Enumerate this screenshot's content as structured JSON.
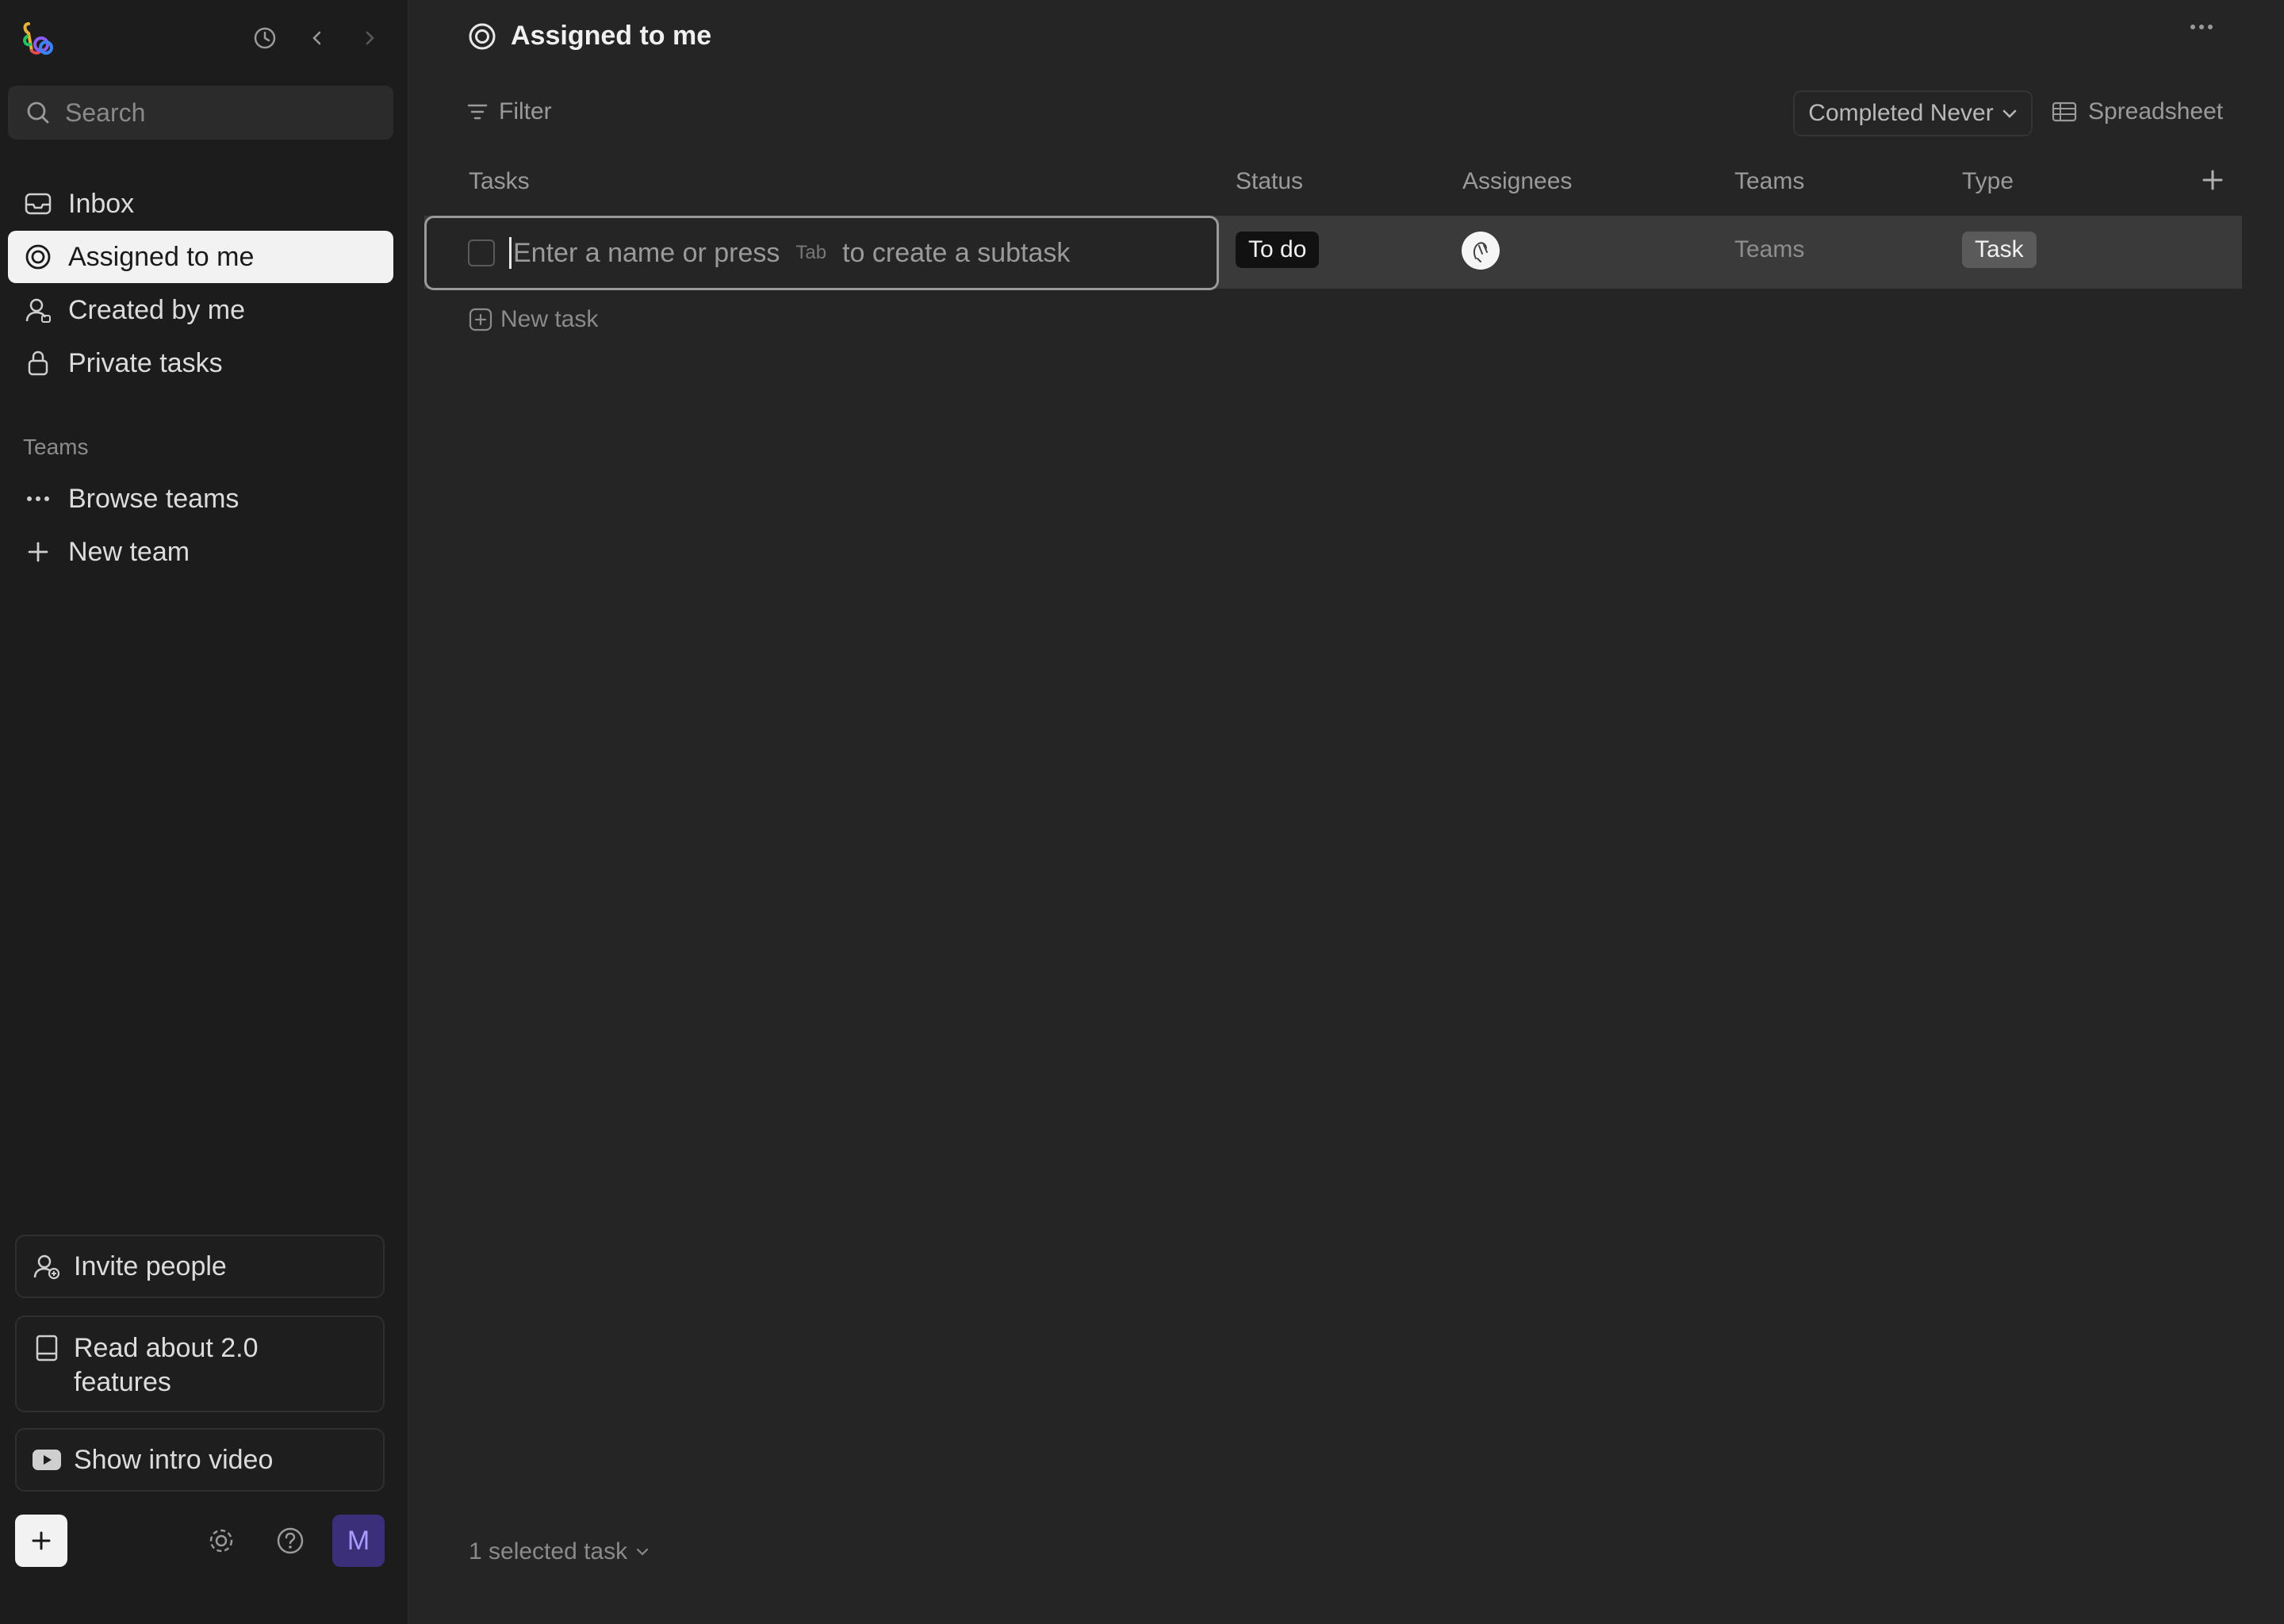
{
  "sidebar": {
    "search": {
      "placeholder": "Search"
    },
    "nav": [
      {
        "label": "Inbox",
        "icon": "inbox-icon"
      },
      {
        "label": "Assigned to me",
        "icon": "target-icon",
        "active": true
      },
      {
        "label": "Created by me",
        "icon": "user-icon"
      },
      {
        "label": "Private tasks",
        "icon": "lock-icon"
      }
    ],
    "teams_section": {
      "label": "Teams",
      "items": [
        {
          "label": "Browse teams",
          "icon": "more-icon"
        },
        {
          "label": "New team",
          "icon": "plus-icon"
        }
      ]
    },
    "footer_cards": [
      {
        "label": "Invite people",
        "icon": "user-plus-icon"
      },
      {
        "label": "Read about 2.0 features",
        "icon": "book-icon"
      },
      {
        "label": "Show intro video",
        "icon": "youtube-icon"
      }
    ],
    "avatar_initial": "M"
  },
  "header": {
    "title": "Assigned to me"
  },
  "toolbar": {
    "filter_label": "Filter",
    "completed_label": "Completed Never",
    "view_label": "Spreadsheet"
  },
  "table": {
    "columns": [
      "Tasks",
      "Status",
      "Assignees",
      "Teams",
      "Type"
    ],
    "row": {
      "placeholder_before": "Enter a name or press",
      "kbd_hint": "Tab",
      "placeholder_after": "to create a subtask",
      "status": "To do",
      "teams": "Teams",
      "type": "Task"
    },
    "new_task_label": "New task"
  },
  "footer": {
    "selected_label": "1 selected task"
  },
  "colors": {
    "background": "#252525",
    "sidebar": "#1c1c1c",
    "active_nav": "#f2f2f2",
    "avatar_bg": "#3b2f7a",
    "avatar_fg": "#a99bff"
  }
}
